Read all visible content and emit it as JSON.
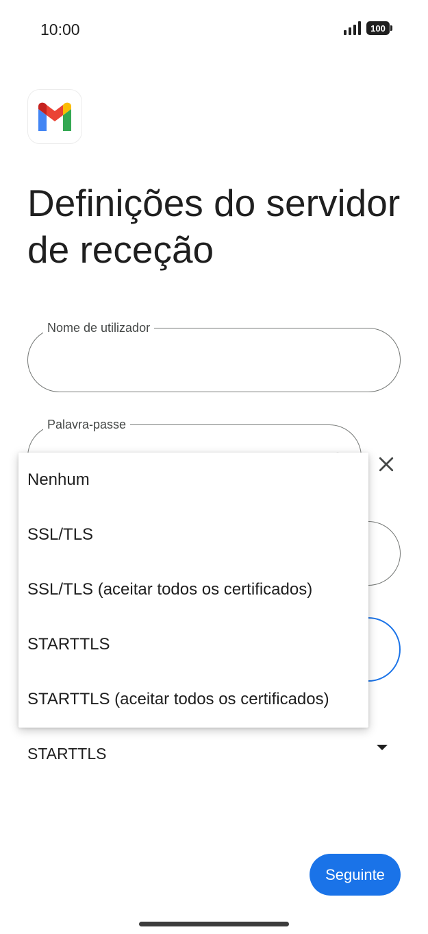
{
  "status_bar": {
    "time": "10:00",
    "signal_icon": "signal-icon",
    "battery_level": "100"
  },
  "app": {
    "logo_icon": "gmail-logo-icon",
    "brand_colors": {
      "red": "#EA4335",
      "blue": "#4285F4",
      "green": "#34A853",
      "yellow": "#FBBC04",
      "dark_red": "#C5221F"
    }
  },
  "page": {
    "title": "Definições do servidor de receção"
  },
  "form": {
    "username": {
      "label": "Nome de utilizador",
      "value": ""
    },
    "password": {
      "label": "Palavra-passe",
      "value": ""
    },
    "security": {
      "selected": "STARTTLS"
    }
  },
  "menu": {
    "items": [
      "Nenhum",
      "SSL/TLS",
      "SSL/TLS (aceitar todos os certificados)",
      "STARTTLS",
      "STARTTLS (aceitar todos os certificados)"
    ]
  },
  "actions": {
    "next_label": "Seguinte"
  },
  "colors": {
    "accent": "#1a73e8",
    "outline": "#747775",
    "text": "#1f1f1f"
  }
}
